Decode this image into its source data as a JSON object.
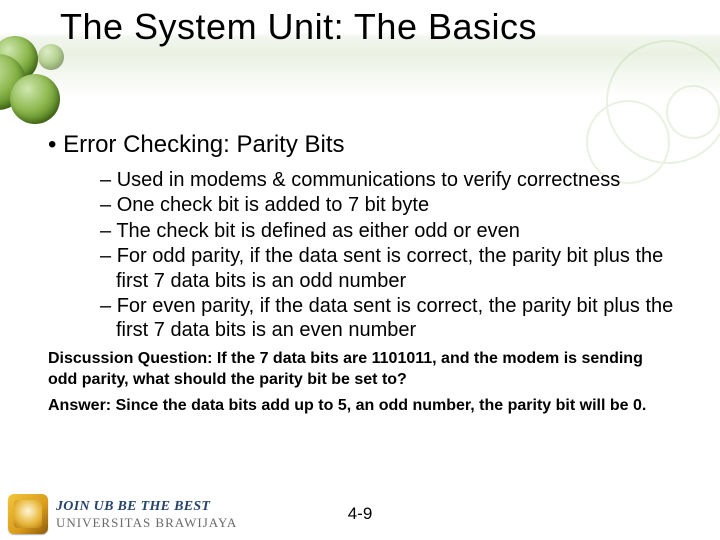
{
  "title": "The System Unit: The Basics",
  "bullet_main": "Error Checking: Parity Bits",
  "subs": [
    "Used in modems & communications to verify correctness",
    "One check bit is added to 7 bit byte",
    "The check bit is defined as either odd or even",
    "For odd parity, if the data sent is correct, the parity bit plus the first 7 data bits is an odd number",
    "For even parity, if the data sent is correct, the parity bit plus the first 7 data bits is an even number"
  ],
  "discussion_q": "Discussion Question: If the 7 data bits are 1101011, and the modem is sending odd parity, what should the parity bit be set to?",
  "discussion_a": "Answer: Since the data bits add up to 5, an odd number, the parity bit will be 0.",
  "page": "4-9",
  "footer": {
    "line1": "JOIN UB BE THE BEST",
    "line2": "UNIVERSITAS BRAWIJAYA"
  }
}
